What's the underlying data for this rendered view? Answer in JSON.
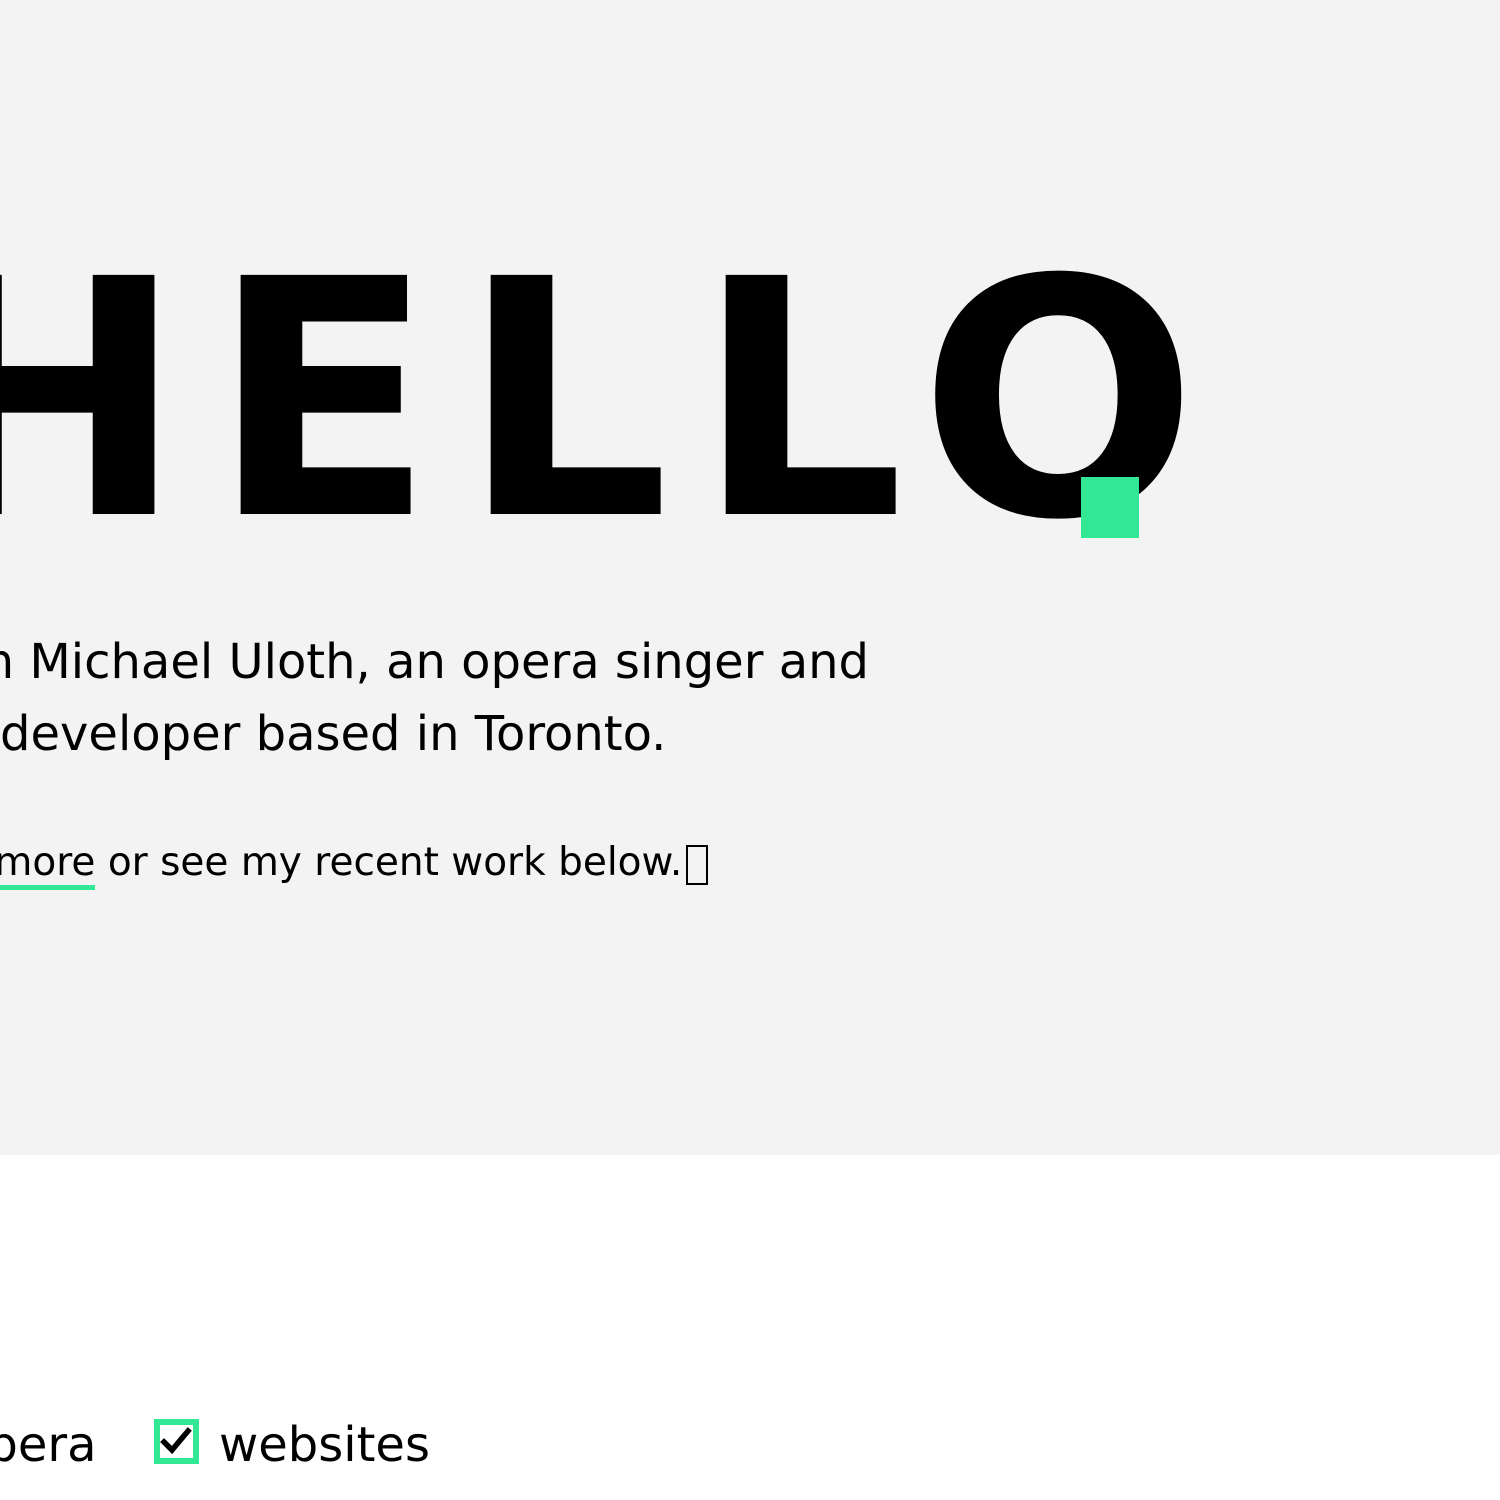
{
  "hero": {
    "title": "HELLO",
    "intro_line1": "I'm Michael Uloth, an opera singer and",
    "intro_line2": "developer based in Toronto.",
    "cta_link": "Read more",
    "cta_rest": " or see my recent work below."
  },
  "filters": {
    "opera_label": "opera",
    "opera_checked": true,
    "websites_label": "websites",
    "websites_checked": true
  },
  "colors": {
    "accent": "#32e895",
    "hero_background": "#f3f3f3",
    "page_background": "#ffffff",
    "text": "#000000"
  },
  "icons": {
    "cta_arrow": "arrow-down-icon",
    "checkbox_check": "checkmark-icon"
  }
}
